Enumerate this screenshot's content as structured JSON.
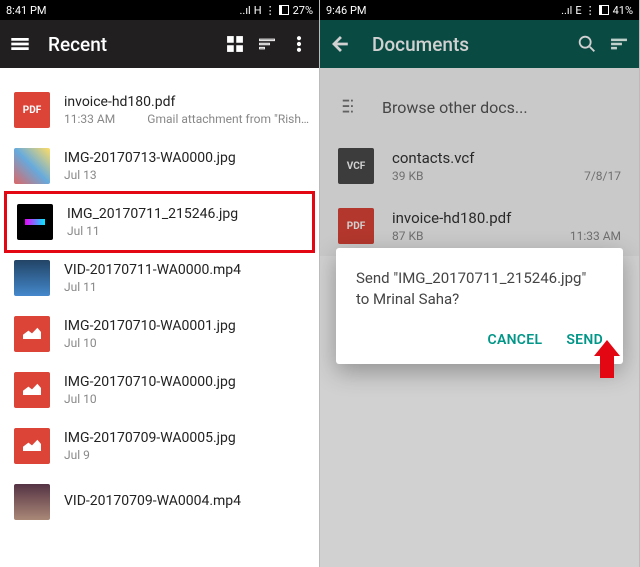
{
  "left": {
    "status": {
      "time": "8:41 PM",
      "battery": "27%",
      "net": "H"
    },
    "toolbar": {
      "title": "Recent"
    },
    "files": [
      {
        "name": "invoice-hd180.pdf",
        "sub_left": "11:33 AM",
        "sub_right": "Gmail attachment from \"Rish…",
        "thumb": "pdf",
        "badge": "PDF"
      },
      {
        "name": "IMG-20170713-WA0000.jpg",
        "sub_left": "Jul 13",
        "sub_right": "",
        "thumb": "ph-img1",
        "badge": ""
      },
      {
        "name": "IMG_20170711_215246.jpg",
        "sub_left": "Jul 11",
        "sub_right": "",
        "thumb": "ph-img2",
        "badge": "",
        "highlight": true
      },
      {
        "name": "VID-20170711-WA0000.mp4",
        "sub_left": "Jul 11",
        "sub_right": "",
        "thumb": "ph-vid1",
        "badge": ""
      },
      {
        "name": "IMG-20170710-WA0001.jpg",
        "sub_left": "Jul 10",
        "sub_right": "",
        "thumb": "ph-generic",
        "badge": ""
      },
      {
        "name": "IMG-20170710-WA0000.jpg",
        "sub_left": "Jul 10",
        "sub_right": "",
        "thumb": "ph-generic",
        "badge": ""
      },
      {
        "name": "IMG-20170709-WA0005.jpg",
        "sub_left": "Jul 9",
        "sub_right": "",
        "thumb": "ph-generic",
        "badge": ""
      },
      {
        "name": "VID-20170709-WA0004.mp4",
        "sub_left": "",
        "sub_right": "",
        "thumb": "ph-vid2",
        "badge": ""
      }
    ]
  },
  "right": {
    "status": {
      "time": "9:46 PM",
      "battery": "41%",
      "net": "E"
    },
    "toolbar": {
      "title": "Documents"
    },
    "browse_label": "Browse other docs...",
    "files": [
      {
        "name": "contacts.vcf",
        "sub_left": "39 KB",
        "sub_right": "7/8/17",
        "thumb": "vcf",
        "badge": "VCF"
      },
      {
        "name": "invoice-hd180.pdf",
        "sub_left": "87 KB",
        "sub_right": "11:33 AM",
        "thumb": "pdf",
        "badge": "PDF"
      }
    ],
    "dialog": {
      "text": "Send \"IMG_20170711_215246.jpg\" to Mrinal Saha?",
      "cancel": "CANCEL",
      "send": "SEND"
    }
  }
}
